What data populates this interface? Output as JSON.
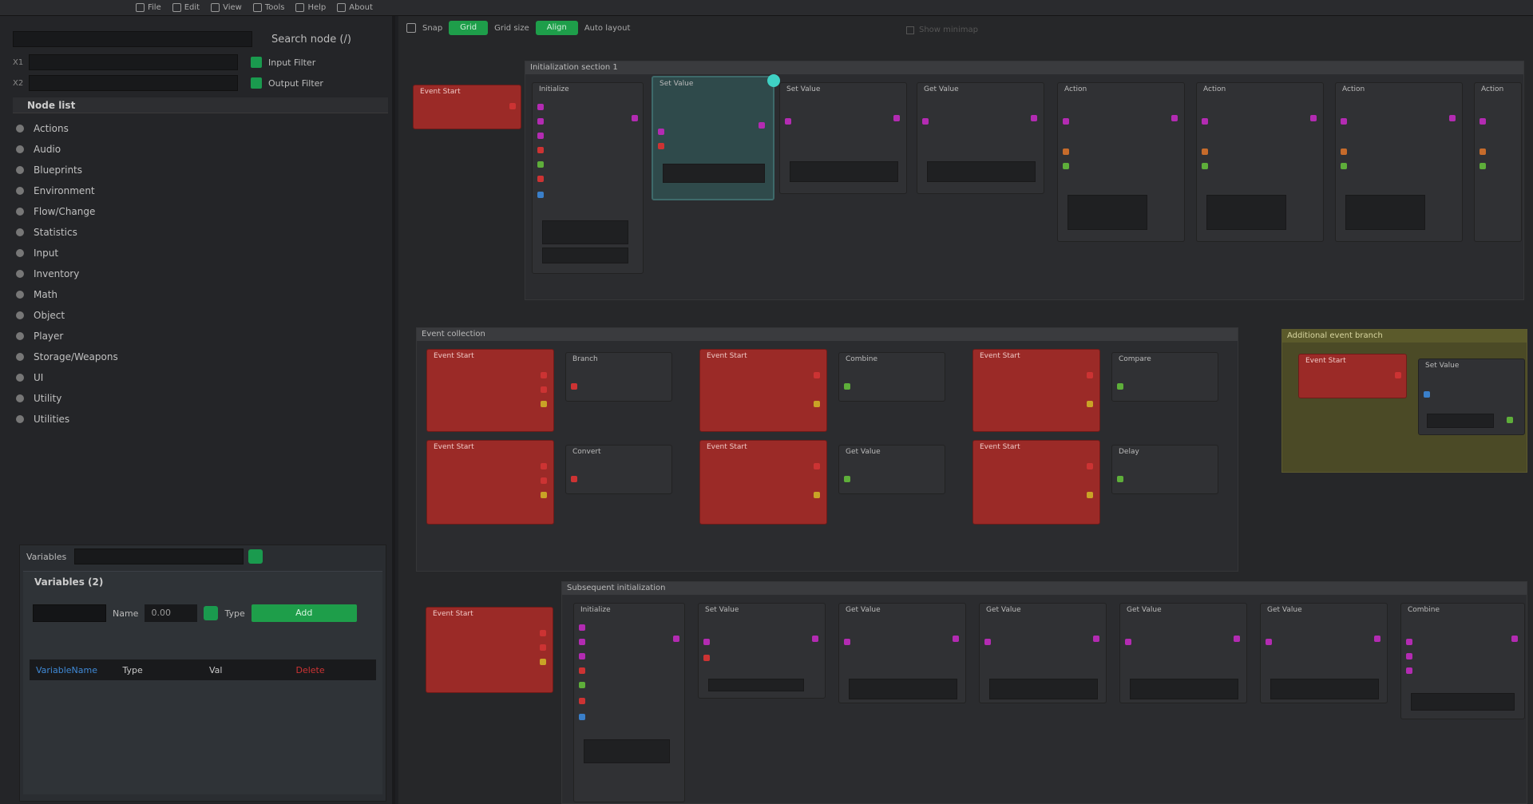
{
  "topbar": {
    "title": "",
    "menu": [
      "File",
      "Edit",
      "View",
      "Tools",
      "Help",
      "About"
    ]
  },
  "left_panel": {
    "search_label": "Search node (/)",
    "options": [
      {
        "key": "X1",
        "label": "Input Filter"
      },
      {
        "key": "X2",
        "label": "Output Filter"
      }
    ],
    "node_list_title": "Node list",
    "node_list": [
      "Actions",
      "Audio",
      "Blueprints",
      "Environment",
      "Flow/Change",
      "Statistics",
      "Input",
      "Inventory",
      "Math",
      "Object",
      "Player",
      "Storage/Weapons",
      "UI",
      "Utility",
      "Utilities"
    ],
    "variables": {
      "label": "Variables",
      "sub_title": "Variables (2)",
      "name_label": "Name",
      "value": "0.00",
      "type_label": "Type",
      "add_button": "Add",
      "row": [
        "VariableName",
        "Type",
        "Val",
        "Delete"
      ]
    }
  },
  "canvas": {
    "toolbar": {
      "snap_label": "Snap",
      "pill1": "Grid",
      "grid_label": "Grid size",
      "pill2": "Align",
      "align_label": "Auto layout",
      "right_label": "Show minimap"
    },
    "groups": {
      "g1": "Initialization section 1",
      "g2": "Event collection",
      "g3": "Additional event branch",
      "g4": "Subsequent initialization"
    },
    "node_titles": {
      "event": "Event Start",
      "init": "Initialize",
      "set": "Set Value",
      "get": "Get Value",
      "action": "Action",
      "branch": "Branch",
      "combine": "Combine",
      "cmp": "Compare",
      "convert": "Convert",
      "delay": "Delay"
    }
  },
  "colors": {
    "bg": "#1e1f22",
    "event_red": "#9b2a27",
    "accent_green": "#1e9e4a",
    "teal_selected": "#3fd1c4",
    "pin_magenta": "#b32bb2"
  }
}
